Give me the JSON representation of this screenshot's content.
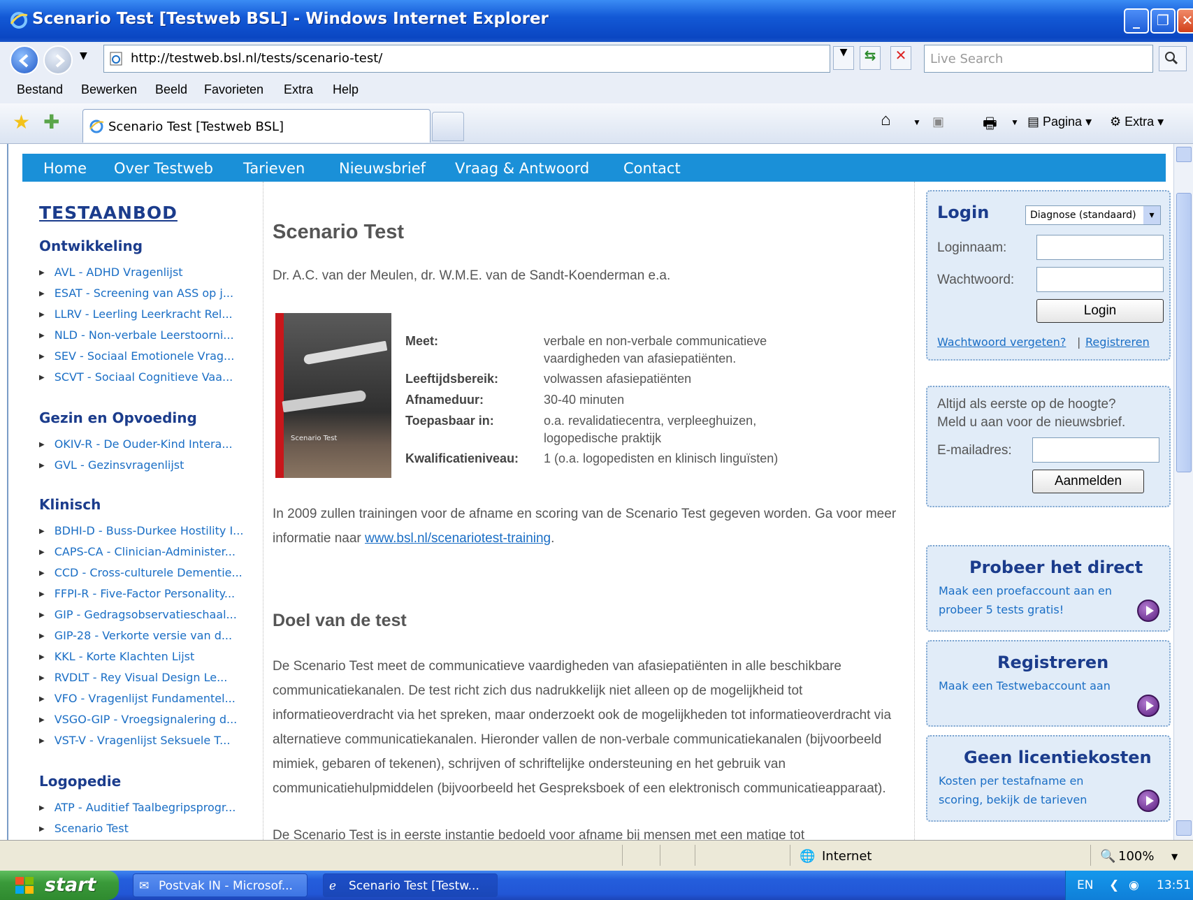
{
  "window": {
    "title": "Scenario Test [Testweb BSL] - Windows Internet Explorer",
    "url": "http://testweb.bsl.nl/tests/scenario-test/",
    "search_placeholder": "Live Search"
  },
  "menu": [
    "Bestand",
    "Bewerken",
    "Beeld",
    "Favorieten",
    "Extra",
    "Help"
  ],
  "tab": {
    "label": "Scenario Test [Testweb BSL]"
  },
  "commands": {
    "page": "Pagina",
    "extra": "Extra"
  },
  "topnav": [
    "Home",
    "Over Testweb",
    "Tarieven",
    "Nieuwsbrief",
    "Vraag & Antwoord",
    "Contact"
  ],
  "sidebar": {
    "heading": "TESTAANBOD",
    "categories": [
      {
        "name": "Ontwikkeling",
        "items": [
          "AVL - ADHD Vragenlijst",
          "ESAT - Screening van ASS op j...",
          "LLRV - Leerling Leerkracht Rel...",
          "NLD - Non-verbale Leerstoorni...",
          "SEV - Sociaal Emotionele Vrag...",
          "SCVT - Sociaal Cognitieve Vaa..."
        ]
      },
      {
        "name": "Gezin en Opvoeding",
        "items": [
          "OKIV-R - De Ouder-Kind Intera...",
          "GVL - Gezinsvragenlijst"
        ]
      },
      {
        "name": "Klinisch",
        "items": [
          "BDHI-D - Buss-Durkee Hostility I...",
          "CAPS-CA - Clinician-Administer...",
          "CCD - Cross-culturele Dementie...",
          "FFPI-R - Five-Factor Personality...",
          "GIP - Gedragsobservatieschaal...",
          "GIP-28 - Verkorte versie van d...",
          "KKL - Korte Klachten Lijst",
          "RVDLT - Rey Visual Design Le...",
          "VFO - Vragenlijst Fundamentel...",
          "VSGO-GIP - Vroegsignalering d...",
          "VST-V - Vragenlijst Seksuele T..."
        ]
      },
      {
        "name": "Logopedie",
        "items": [
          "ATP - Auditief Taalbegripsprogr...",
          "Scenario Test"
        ]
      }
    ]
  },
  "main": {
    "title": "Scenario Test",
    "authors": "Dr. A.C. van der Meulen, dr. W.M.E. van de Sandt-Koenderman e.a.",
    "cover_title": "Scenario Test",
    "details": [
      {
        "label": "Meet:",
        "value": "verbale en non-verbale communicatieve vaardigheden van afasiepatiënten."
      },
      {
        "label": "Leeftijdsbereik:",
        "value": "volwassen afasiepatiënten"
      },
      {
        "label": "Afnameduur:",
        "value": "30-40 minuten"
      },
      {
        "label": "Toepasbaar in:",
        "value": "o.a. revalidatiecentra, verpleeghuizen, logopedische praktijk"
      },
      {
        "label": "Kwalificatieniveau:",
        "value": "1 (o.a. logopedisten en klinisch linguïsten)"
      }
    ],
    "training_text": "In 2009 zullen trainingen voor de afname en scoring van de Scenario Test gegeven worden. Ga voor meer informatie naar ",
    "training_link": "www.bsl.nl/scenariotest-training",
    "training_end": ".",
    "section_title": "Doel van de test",
    "paragraph1": "De Scenario Test meet de communicatieve vaardigheden van afasiepatiënten in alle beschikbare communicatiekanalen. De test richt zich dus nadrukkelijk niet alleen op de mogelijkheid tot informatieoverdracht via het spreken, maar onderzoekt ook de mogelijkheden tot informatieoverdracht via alternatieve communicatiekanalen. Hieronder vallen de non-verbale communicatiekanalen (bijvoorbeeld mimiek, gebaren of tekenen), schrijven of schriftelijke ondersteuning en het gebruik van communicatiehulpmiddelen (bijvoorbeeld het Gespreksboek of een elektronisch communicatieapparaat).",
    "paragraph2": "De Scenario Test is in eerste instantie bedoeld voor afname bij mensen met een matige tot"
  },
  "login": {
    "title": "Login",
    "select_value": "Diagnose (standaard)",
    "username_label": "Loginnaam:",
    "password_label": "Wachtwoord:",
    "button": "Login",
    "forgot_link": "Wachtwoord vergeten?",
    "separator": "|",
    "register_link": "Registreren"
  },
  "newsletter": {
    "text1": "Altijd als eerste op de hoogte?",
    "text2": "Meld u aan voor de nieuwsbrief.",
    "email_label": "E-mailadres:",
    "button": "Aanmelden"
  },
  "promos": [
    {
      "title": "Probeer het direct",
      "text": "Maak een proefaccount aan en probeer 5 tests gratis!"
    },
    {
      "title": "Registreren",
      "text": "Maak een Testwebaccount aan"
    },
    {
      "title": "Geen licentiekosten",
      "text": "Kosten per testafname en scoring, bekijk de tarieven"
    }
  ],
  "statusbar": {
    "zone": "Internet",
    "zoom": "100%"
  },
  "taskbar": {
    "start": "start",
    "tasks": [
      "Postvak IN - Microsof...",
      "Scenario Test [Testw..."
    ],
    "lang": "EN",
    "time": "13:51"
  },
  "colors": {
    "nav": "#1a90d8",
    "heading": "#1b3c8c",
    "link": "#1a6ec5",
    "box_bg": "#e1ecf8"
  }
}
